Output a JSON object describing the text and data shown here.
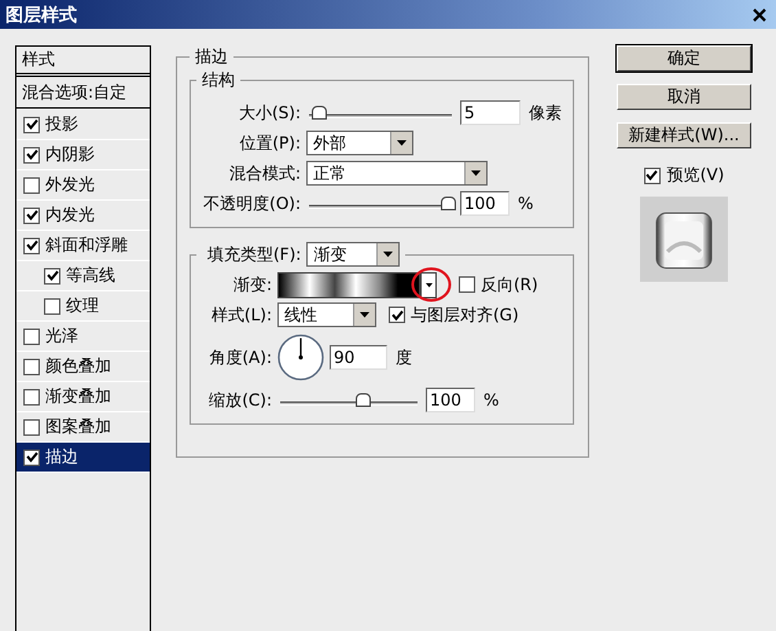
{
  "window": {
    "title": "图层样式"
  },
  "styles": {
    "header": "样式",
    "blend_options": "混合选项:自定",
    "items": [
      {
        "label": "投影",
        "checked": true,
        "selected": false
      },
      {
        "label": "内阴影",
        "checked": true,
        "selected": false
      },
      {
        "label": "外发光",
        "checked": false,
        "selected": false
      },
      {
        "label": "内发光",
        "checked": true,
        "selected": false
      },
      {
        "label": "斜面和浮雕",
        "checked": true,
        "selected": false,
        "children": [
          {
            "label": "等高线",
            "checked": true,
            "selected": false
          },
          {
            "label": "纹理",
            "checked": false,
            "selected": false
          }
        ]
      },
      {
        "label": "光泽",
        "checked": false,
        "selected": false
      },
      {
        "label": "颜色叠加",
        "checked": false,
        "selected": false
      },
      {
        "label": "渐变叠加",
        "checked": false,
        "selected": false
      },
      {
        "label": "图案叠加",
        "checked": false,
        "selected": false
      },
      {
        "label": "描边",
        "checked": true,
        "selected": true
      }
    ]
  },
  "stroke": {
    "title": "描边",
    "structure": {
      "title": "结构",
      "size": {
        "label": "大小(S):",
        "level": 0.02,
        "value": "5",
        "unit": "像素"
      },
      "position": {
        "label": "位置(P):",
        "value": "外部"
      },
      "blend_mode": {
        "label": "混合模式:",
        "value": "正常"
      },
      "opacity": {
        "label": "不透明度(O):",
        "level": 1,
        "value": "100",
        "unit": "%"
      }
    },
    "fill": {
      "label": "填充类型(F):",
      "value": "渐变",
      "gradient_label": "渐变:",
      "reverse": {
        "label": "反向(R)",
        "checked": false
      },
      "style": {
        "label": "样式(L):",
        "value": "线性"
      },
      "align": {
        "label": "与图层对齐(G)",
        "checked": true
      },
      "angle": {
        "label": "角度(A):",
        "value": "90",
        "unit": "度"
      },
      "scale": {
        "label": "缩放(C):",
        "level": 0.6,
        "value": "100",
        "unit": "%"
      }
    }
  },
  "buttons": [
    "确定",
    "取消",
    "新建样式(W)..."
  ],
  "preview": {
    "label": "预览(V)",
    "checked": true
  }
}
